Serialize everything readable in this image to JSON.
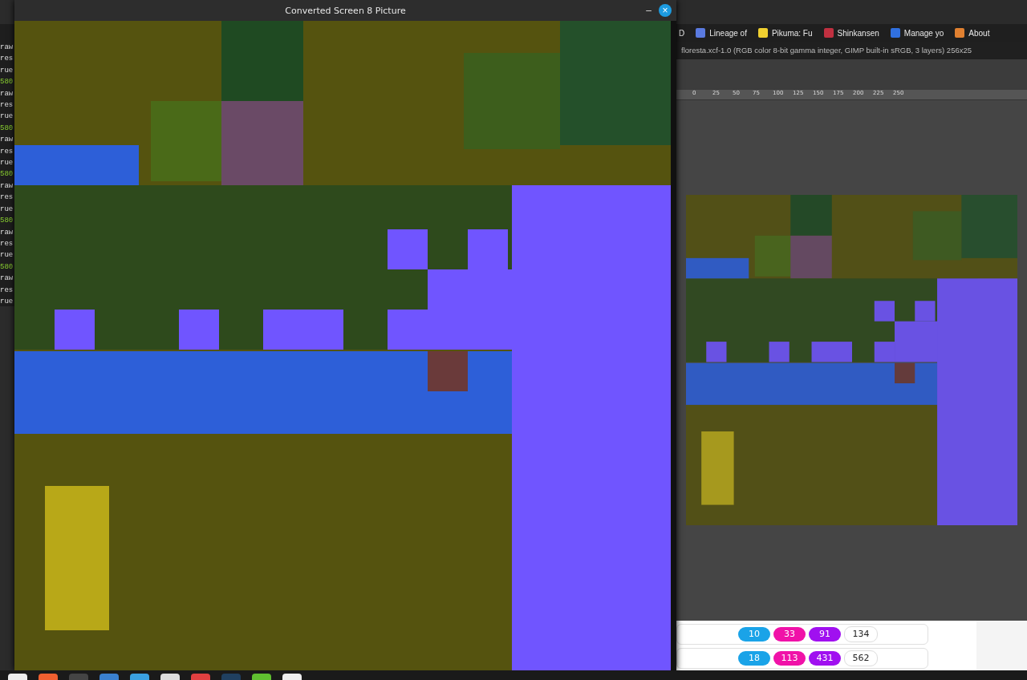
{
  "terminal": {
    "lines": [
      {
        "text": "raw",
        "kind": "plain"
      },
      {
        "text": "res",
        "kind": "plain"
      },
      {
        "text": "rue",
        "kind": "plain"
      },
      {
        "text": "580",
        "kind": "number"
      },
      {
        "text": "raw",
        "kind": "plain"
      },
      {
        "text": "res",
        "kind": "plain"
      },
      {
        "text": "rue",
        "kind": "plain"
      },
      {
        "text": "580",
        "kind": "number"
      },
      {
        "text": "raw",
        "kind": "plain"
      },
      {
        "text": "res",
        "kind": "plain"
      },
      {
        "text": "rue",
        "kind": "plain"
      },
      {
        "text": "580",
        "kind": "number"
      },
      {
        "text": "raw",
        "kind": "plain"
      },
      {
        "text": "res",
        "kind": "plain"
      },
      {
        "text": "rue",
        "kind": "plain"
      },
      {
        "text": "580",
        "kind": "number"
      },
      {
        "text": "raw",
        "kind": "plain"
      },
      {
        "text": "res",
        "kind": "plain"
      },
      {
        "text": "rue",
        "kind": "plain"
      },
      {
        "text": "580",
        "kind": "number"
      },
      {
        "text": "raw",
        "kind": "plain"
      },
      {
        "text": "res",
        "kind": "plain"
      },
      {
        "text": "rue",
        "kind": "plain"
      }
    ]
  },
  "browser": {
    "bookmarks": [
      "D",
      "Lineage of",
      "Pikuma: Fu",
      "Shinkansen",
      "Manage yo",
      "About"
    ],
    "badge_rows": [
      [
        "10",
        "33",
        "91",
        "134"
      ],
      [
        "18",
        "113",
        "431",
        "562"
      ]
    ]
  },
  "gimp": {
    "title": "floresta.xcf-1.0 (RGB color 8-bit gamma integer, GIMP built-in sRGB, 3 layers) 256x25",
    "ruler": [
      "0",
      "25",
      "50",
      "75",
      "100",
      "125",
      "150",
      "175",
      "200",
      "225",
      "250"
    ]
  },
  "viewer": {
    "title": "Converted Screen 8 Picture",
    "minimize": "–",
    "close": "×"
  }
}
